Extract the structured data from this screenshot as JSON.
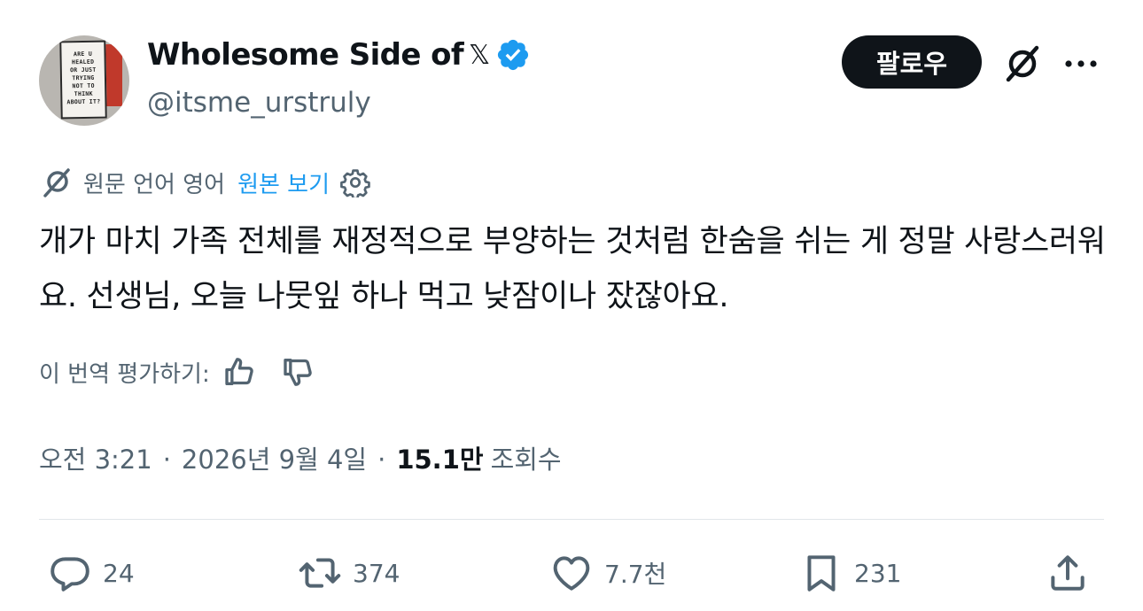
{
  "author": {
    "display_name": "Wholesome Side of",
    "x_glyph": "𝕏",
    "handle": "@itsme_urstruly",
    "verified": true,
    "avatar_sign_text": "ARE U\nHEALED\nOR JUST\nTRYING\nNOT TO\nTHINK\nABOUT IT?"
  },
  "actions_top": {
    "follow_label": "팔로우"
  },
  "translation": {
    "original_language_label": "원문 언어 영어",
    "show_original_label": "원본 보기"
  },
  "tweet": {
    "text": "개가 마치 가족 전체를 재정적으로 부양하는 것처럼 한숨을 쉬는 게 정말 사랑스러워요. 선생님, 오늘 나뭇잎 하나 먹고 낮잠이나 잤잖아요."
  },
  "rating": {
    "label": "이 번역 평가하기:"
  },
  "meta": {
    "time": "오전 3:21",
    "separator": "·",
    "date": "2026년 9월 4일",
    "views_count": "15.1만",
    "views_label": "조회수"
  },
  "engagement": {
    "replies": "24",
    "reposts": "374",
    "likes": "7.7천",
    "bookmarks": "231"
  },
  "colors": {
    "text_primary": "#0f1419",
    "text_secondary": "#536471",
    "link_blue": "#1d9bf0",
    "verified_blue": "#1d9bf0",
    "divider": "#e1e6ea"
  }
}
